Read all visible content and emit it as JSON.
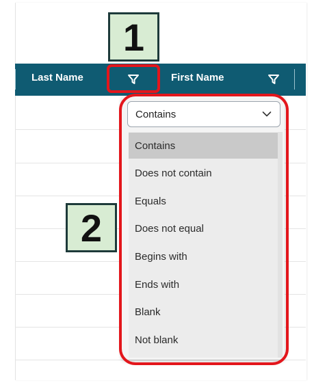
{
  "grid": {
    "columns": [
      {
        "title": "Last Name",
        "filter_icon": "filter-icon"
      },
      {
        "title": "First Name",
        "filter_icon": "filter-icon"
      }
    ]
  },
  "callouts": {
    "one": "1",
    "two": "2"
  },
  "filter_menu": {
    "selected_value": "Contains",
    "chevron_icon": "chevron-down-icon",
    "options": [
      "Contains",
      "Does not contain",
      "Equals",
      "Does not equal",
      "Begins with",
      "Ends with",
      "Blank",
      "Not blank"
    ],
    "highlighted_option": "Contains"
  },
  "colors": {
    "header_bg": "#0f5b72",
    "callout_bg": "#d8ecd3",
    "highlight_red": "#e3161c"
  }
}
